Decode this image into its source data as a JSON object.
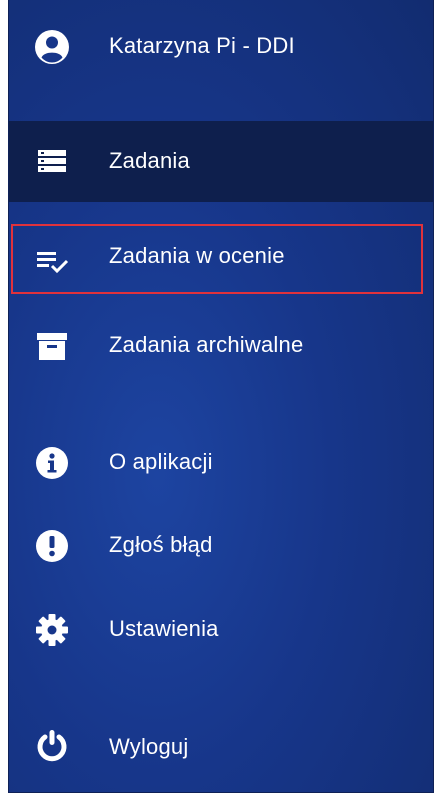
{
  "user": {
    "name": "Katarzyna Pi - DDI",
    "icon": "account-circle-icon"
  },
  "menu": {
    "items": [
      {
        "key": "zadania",
        "label": "Zadania",
        "icon": "list-icon",
        "active": true
      },
      {
        "key": "zadania_w_ocenie",
        "label": "Zadania w ocenie",
        "icon": "playlist-check-icon",
        "active": false,
        "highlighted": true
      },
      {
        "key": "zadania_archiwalne",
        "label": "Zadania archiwalne",
        "icon": "archive-icon",
        "active": false
      }
    ],
    "secondary": [
      {
        "key": "o_aplikacji",
        "label": "O aplikacji",
        "icon": "info-icon"
      },
      {
        "key": "zglos_blad",
        "label": "Zgłoś błąd",
        "icon": "exclamation-icon"
      },
      {
        "key": "ustawienia",
        "label": "Ustawienia",
        "icon": "gear-icon"
      }
    ],
    "footer": [
      {
        "key": "wyloguj",
        "label": "Wyloguj",
        "icon": "power-icon"
      }
    ]
  },
  "colors": {
    "drawer_bg": "#17368a",
    "active_bg": "#0e1f4d",
    "highlight_border": "#e0323c",
    "text": "#ffffff"
  }
}
